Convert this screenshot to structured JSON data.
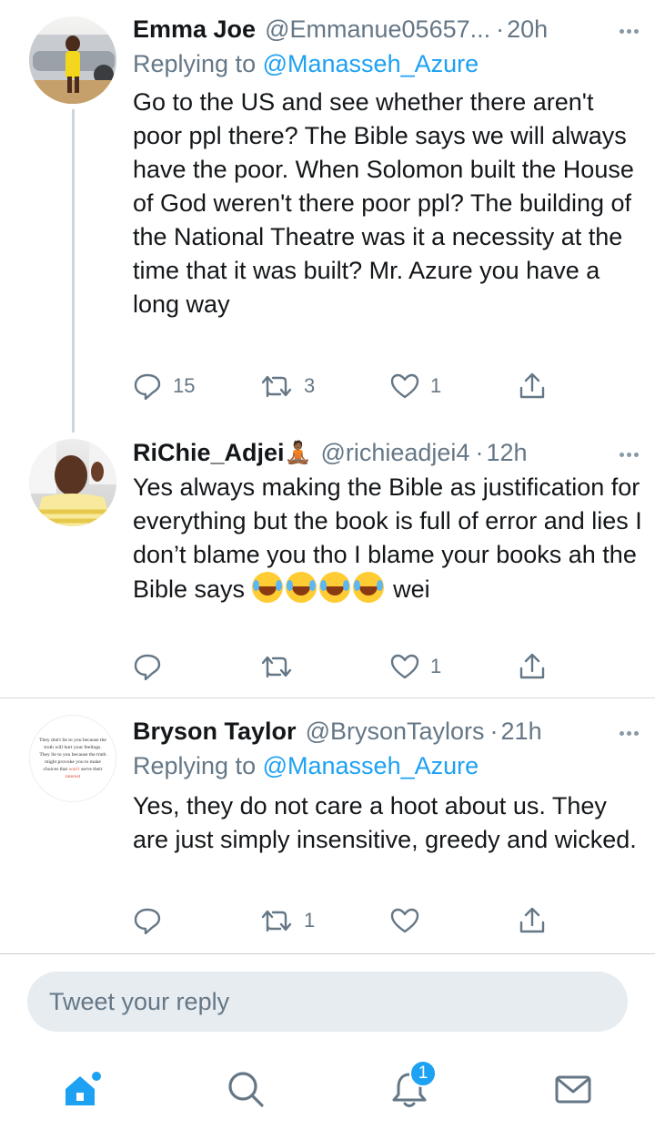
{
  "colors": {
    "accent": "#1da1f2",
    "muted": "#657786",
    "text": "#14171a",
    "divider": "#d5dbe0"
  },
  "tweets": [
    {
      "name": "Emma Joe",
      "handle": "@Emmanue05657...",
      "time": "20h",
      "reply_label": "Replying to",
      "reply_to": "@Manasseh_Azure",
      "text": "Go to the US and see whether there aren't poor ppl there? The Bible says we will always have the poor. When Solomon built the House of God weren't there poor ppl? The building of the National Theatre was it a necessity at the time that it was built? Mr. Azure you have a long way",
      "replies": "15",
      "retweets": "3",
      "likes": "1"
    },
    {
      "name": "RiChie_Adjei",
      "name_emoji": "🧘🏾",
      "handle": "@richieadjei4",
      "time": "12h",
      "text": "Yes always making the Bible as justification for everything but the book is full of error and lies I don’t blame you tho I blame your books ah the Bible says",
      "text_tail": "wei",
      "emoji_count": "4",
      "replies": "",
      "retweets": "",
      "likes": "1"
    },
    {
      "name": "Bryson Taylor",
      "handle": "@BrysonTaylors",
      "time": "21h",
      "reply_label": "Replying to",
      "reply_to": "@Manasseh_Azure",
      "text": "Yes, they do not care a hoot about us. They are just simply insensitive, greedy and wicked.",
      "avatar_quote_a": "They don't lie to you because the truth will hurt your feelings. They lie to you because the truth might provoke you to make choices that",
      "avatar_quote_b": "won't",
      "avatar_quote_c": "serve their",
      "avatar_quote_d": "interest",
      "replies": "",
      "retweets": "1",
      "likes": ""
    }
  ],
  "composer": {
    "placeholder": "Tweet your reply"
  },
  "tabbar": {
    "items": [
      "home-icon",
      "search-icon",
      "notifications-icon",
      "messages-icon"
    ],
    "notification_badge": "1"
  }
}
